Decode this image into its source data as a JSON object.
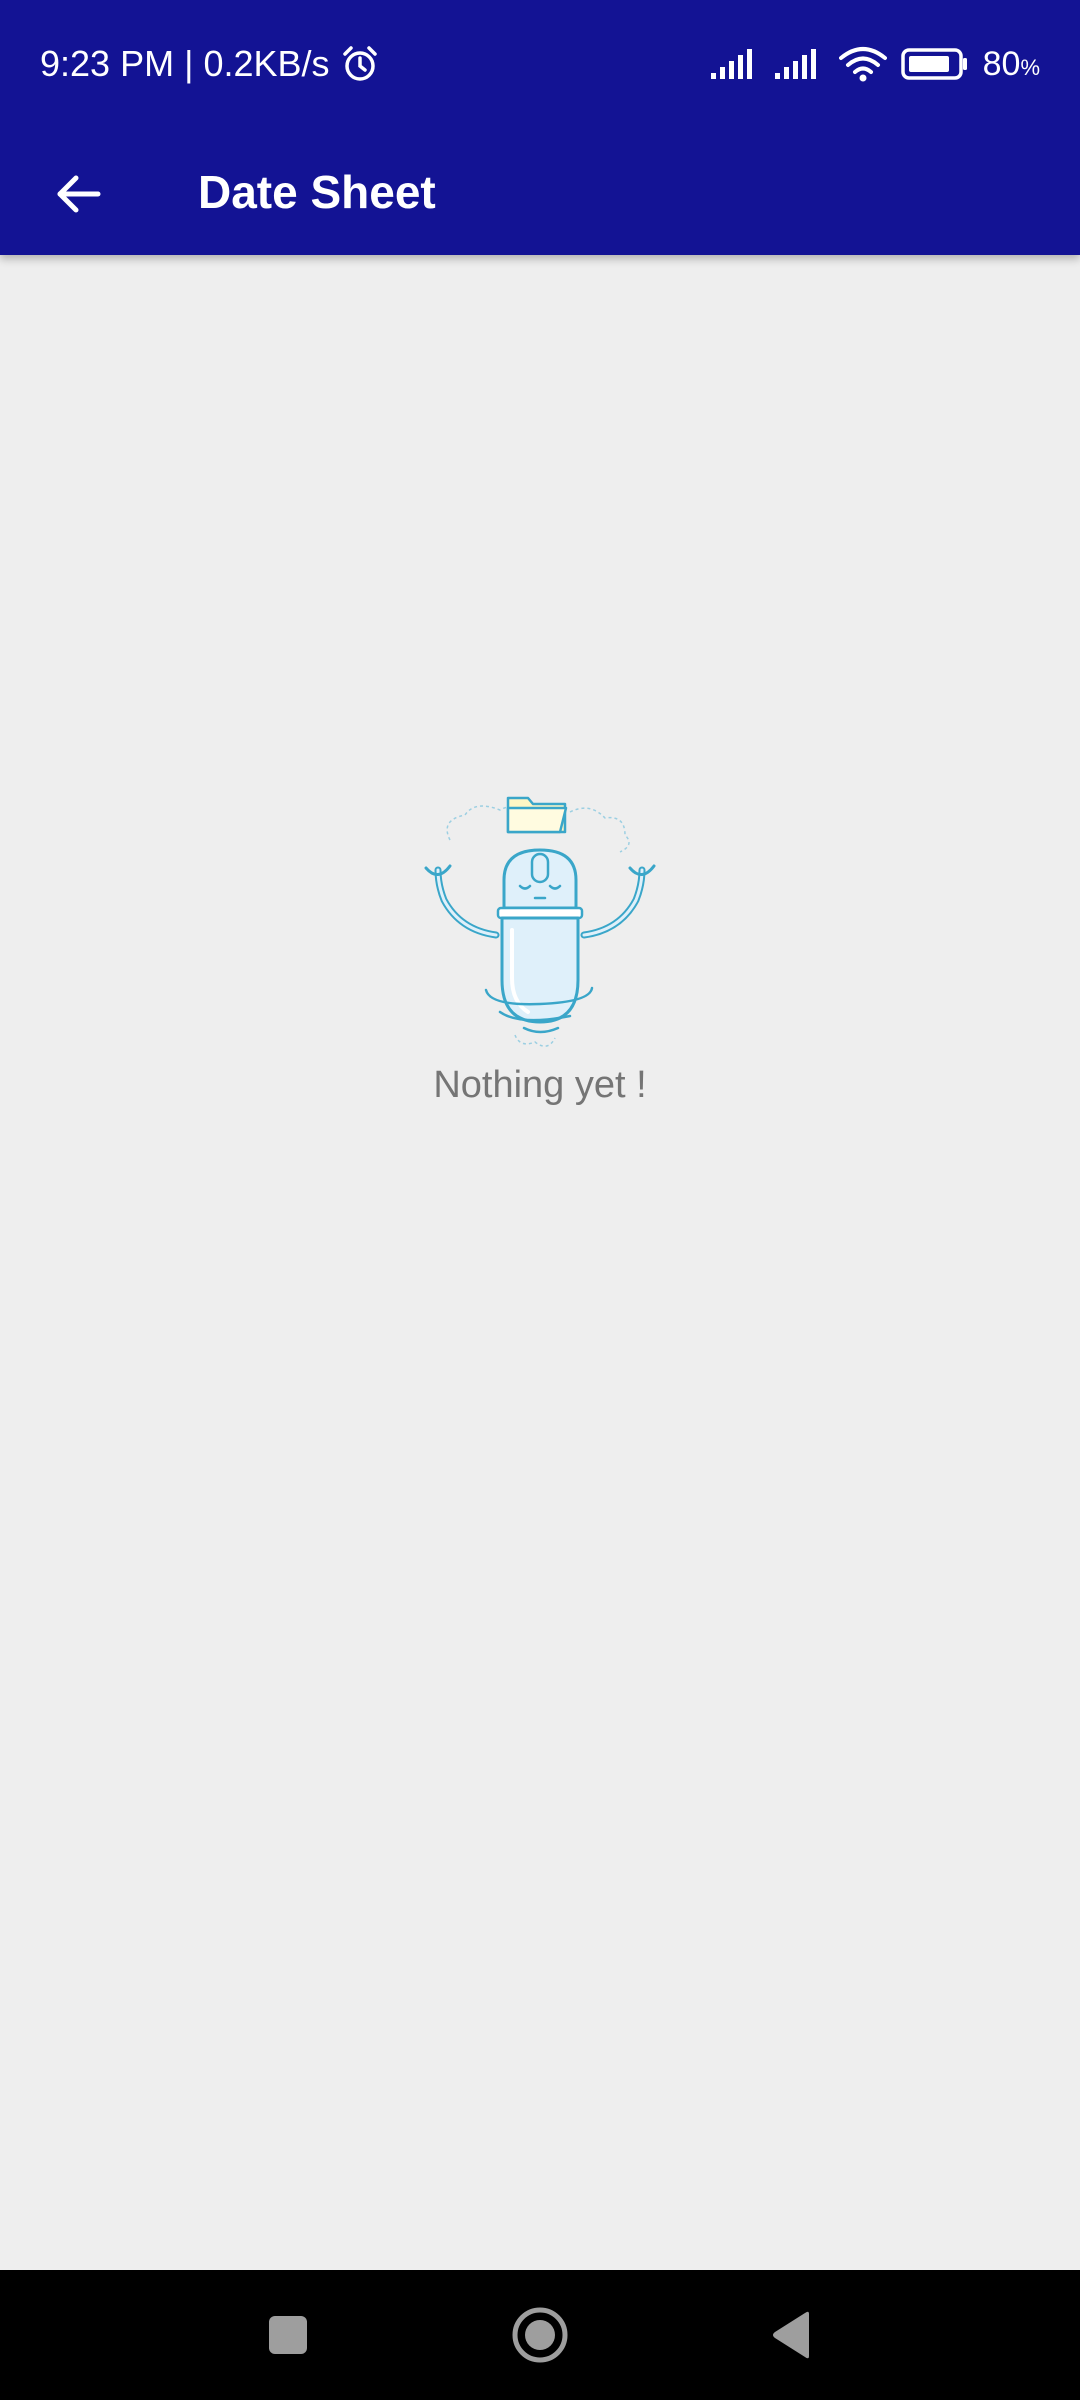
{
  "status_bar": {
    "time": "9:23 PM",
    "separator": "|",
    "network_speed": "0.2KB/s",
    "alarm_icon": "alarm-clock-icon",
    "signal_icons": [
      "signal-bars-icon",
      "signal-bars-icon"
    ],
    "wifi_icon": "wifi-icon",
    "battery_icon": "battery-icon",
    "battery_level": "80",
    "battery_unit": "%"
  },
  "app_bar": {
    "back_icon": "arrow-back-icon",
    "title": "Date Sheet"
  },
  "empty_state": {
    "illustration": "robot-folder-illustration",
    "message": "Nothing yet !"
  },
  "nav_bar": {
    "recents_icon": "square-icon",
    "home_icon": "circle-home-icon",
    "back_icon": "triangle-back-icon"
  },
  "colors": {
    "app_bar": "#131394",
    "background": "#eeeeee",
    "empty_text": "#757575",
    "nav_bar": "#000000",
    "illustration_stroke": "#3aa6c9",
    "illustration_fill": "#dff0fa"
  }
}
